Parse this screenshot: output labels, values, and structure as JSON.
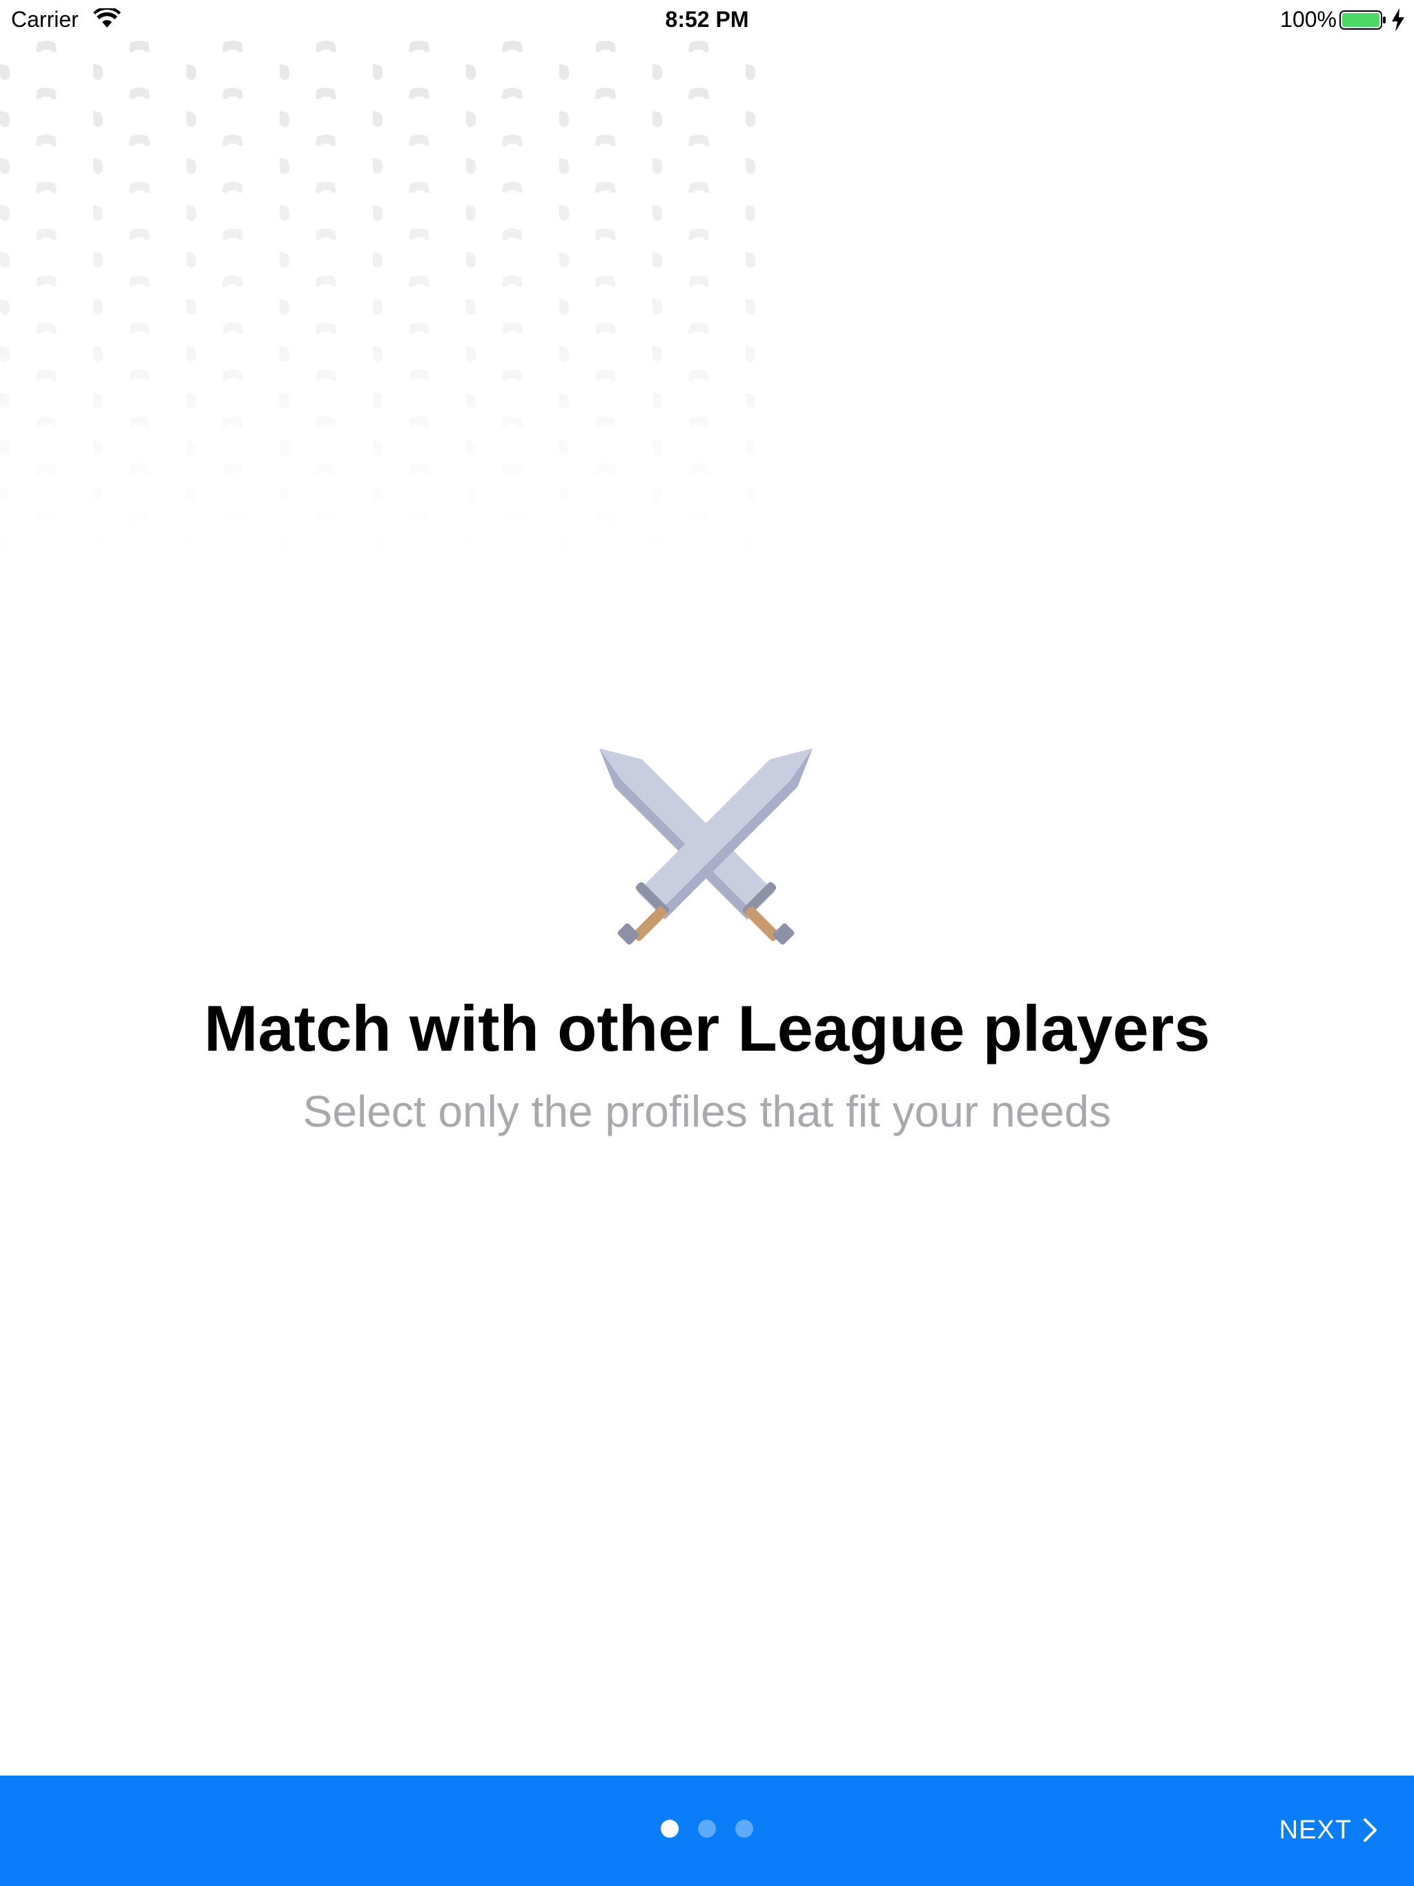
{
  "status_bar": {
    "carrier": "Carrier",
    "time": "8:52 PM",
    "battery": "100%"
  },
  "hero": {
    "icon": "crossed-swords-icon",
    "title": "Match with other League players",
    "subtitle": "Select only the profiles that fit your needs"
  },
  "bottom_bar": {
    "pages": [
      {
        "active": true
      },
      {
        "active": false
      },
      {
        "active": false
      }
    ],
    "next_label": "NEXT"
  },
  "colors": {
    "accent": "#0a7df8",
    "subtitle_gray": "#a8a8ad",
    "battery_green": "#4cd964"
  }
}
